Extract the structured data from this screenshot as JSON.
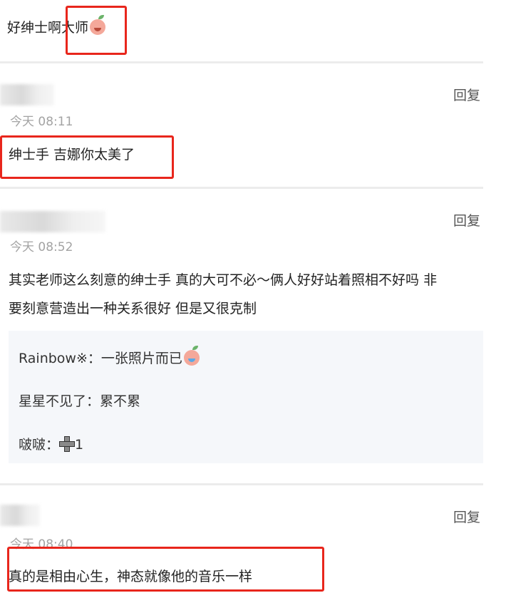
{
  "top": {
    "text": "好绅士啊大师",
    "emoji": "smiling-peach-emoji"
  },
  "reply_label": "回复",
  "comments": [
    {
      "time": "今天 08:11",
      "text": "绅士手 吉娜你太美了"
    },
    {
      "time": "今天 08:52",
      "text_line1": "其实老师这么刻意的绅士手 真的大可不必～俩人好好站着照相不好吗 非",
      "text_line2": "要刻意营造出一种关系很好 但是又很克制",
      "replies": [
        {
          "user": "Rainbow※",
          "sep": "：",
          "text": "一张照片而已",
          "emoji": "crying-peach-emoji"
        },
        {
          "user": "星星不见了",
          "sep": "：",
          "text": "累不累"
        },
        {
          "user": "啵啵",
          "sep": "：",
          "text": "1",
          "icon": "plus-icon"
        }
      ]
    },
    {
      "time": "今天 08:40",
      "text": "真的是相由心生，神态就像他的音乐一样"
    }
  ],
  "colors": {
    "highlight": "#e8261c",
    "divider": "#ececec",
    "time": "#a3a3a3",
    "sub_bg": "#f5f7fa"
  }
}
